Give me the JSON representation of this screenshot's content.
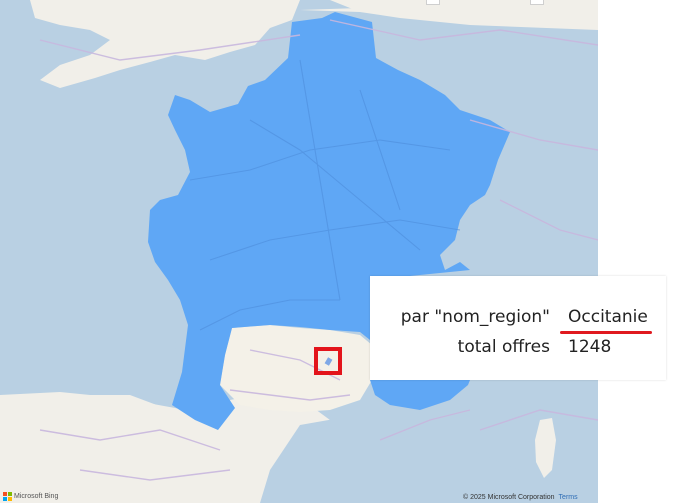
{
  "tooltip": {
    "field_label": "par \"nom_region\"",
    "field_value": "Occitanie",
    "metric_label": "total offres",
    "metric_value": "1248"
  },
  "attribution": {
    "logo_text": "Microsoft Bing",
    "copyright": "© 2025 Microsoft Corporation",
    "terms_link": "Terms"
  },
  "colors": {
    "sea": "#b9d0e3",
    "land": "#f1efe9",
    "region_fill": "#5fa7f5",
    "road": "#c8b7de",
    "highlight": "#e3141b"
  }
}
